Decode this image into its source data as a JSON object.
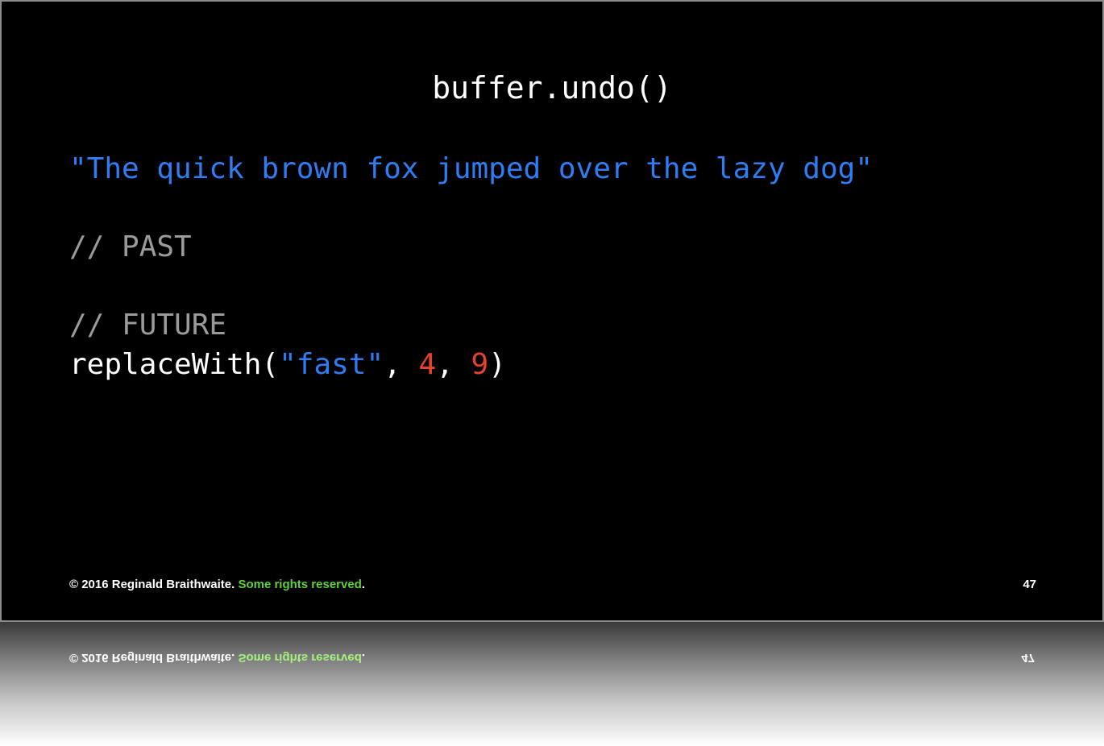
{
  "slide": {
    "title": "buffer.undo()",
    "string_line": "\"The quick brown fox jumped over the lazy dog\"",
    "comment_past": "// PAST",
    "comment_future": "// FUTURE",
    "call": {
      "fn": "replaceWith(",
      "arg_string": "\"fast\"",
      "sep1": ", ",
      "arg_num1": "4",
      "sep2": ", ",
      "arg_num2": "9",
      "close": ")"
    },
    "footer": {
      "copyright": "© 2016 Reginald Braithwaite. ",
      "rights_link": "Some rights reserved",
      "period": "."
    },
    "page_number": "47"
  },
  "colors": {
    "background": "#000000",
    "string": "#2f7df2",
    "comment": "#9a9a9a",
    "number": "#e8412c",
    "link": "#5bd23a"
  }
}
